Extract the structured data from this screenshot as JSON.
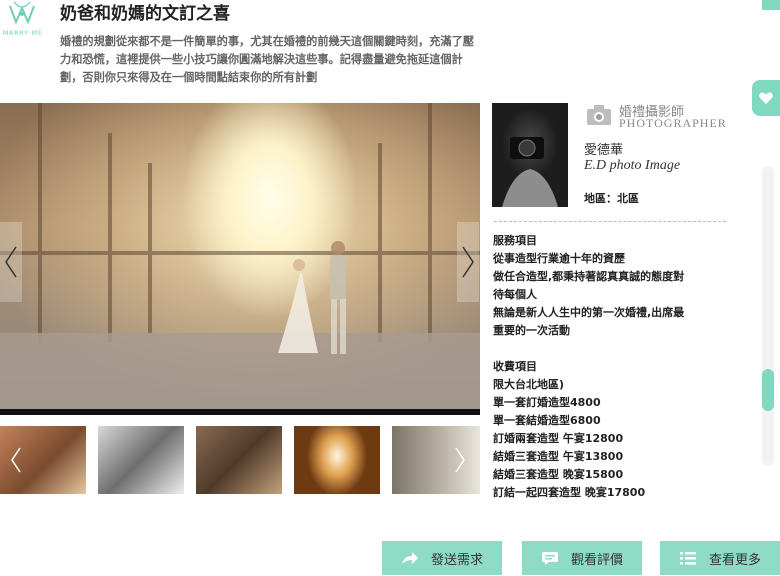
{
  "header": {
    "logo_text": "MARRY·ME",
    "title": "奶爸和奶媽的文訂之喜",
    "intro": "婚禮的規劃從來都不是一件簡單的事，尤其在婚禮的前幾天這個關鍵時刻，充滿了壓力和恐慌，這裡提供一些小技巧讓你圓滿地解決這些事。記得盡量避免拖延這個計劃，否則你只來得及在一個時間點結束你的所有計劃"
  },
  "gallery": {
    "prev_icon": "chevron-left-icon",
    "next_icon": "chevron-right-icon",
    "thumbnails_count": 5
  },
  "photographer": {
    "role_zh": "婚禮攝影師",
    "role_en": "PHOTOGRAPHER",
    "name_zh": "愛德華",
    "name_en": "E.D photo Image",
    "region": "地區：北區",
    "services_title": "服務項目",
    "services": [
      "從事造型行業逾十年的資歷",
      "做任合造型,都秉持著認真真誠的態度對",
      "待每個人",
      "無論是新人人生中的第一次婚禮,出席最",
      "重要的一次活動"
    ],
    "fees_title": "收費項目",
    "fees": [
      "限大台北地區)",
      "單一套訂婚造型4800",
      "單一套結婚造型6800",
      "訂婚兩套造型 午宴12800",
      "結婚三套造型 午宴13800",
      "結婚三套造型 晚宴15800",
      "訂結一起四套造型 晚宴17800"
    ]
  },
  "buttons": {
    "send": "發送需求",
    "reviews": "觀看評價",
    "more": "查看更多"
  },
  "colors": {
    "accent": "#7fd8c0",
    "button": "#8fdcc6"
  }
}
